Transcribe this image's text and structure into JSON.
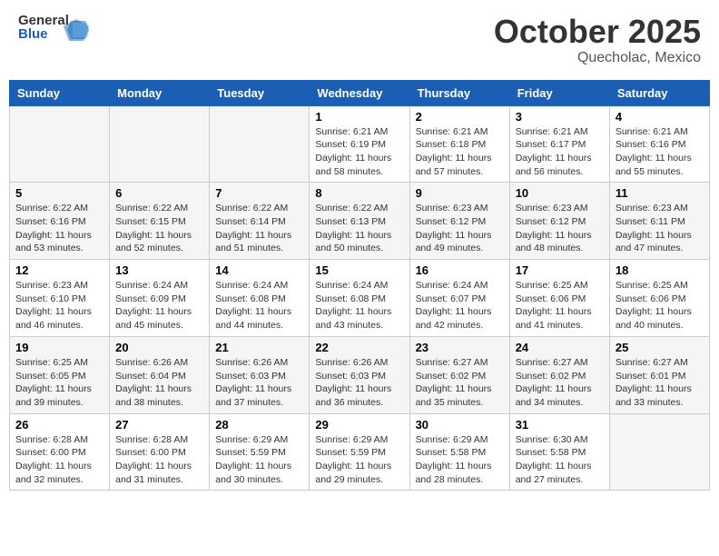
{
  "header": {
    "logo_general": "General",
    "logo_blue": "Blue",
    "month_title": "October 2025",
    "location": "Quecholac, Mexico"
  },
  "weekdays": [
    "Sunday",
    "Monday",
    "Tuesday",
    "Wednesday",
    "Thursday",
    "Friday",
    "Saturday"
  ],
  "weeks": [
    [
      {
        "day": "",
        "info": ""
      },
      {
        "day": "",
        "info": ""
      },
      {
        "day": "",
        "info": ""
      },
      {
        "day": "1",
        "info": "Sunrise: 6:21 AM\nSunset: 6:19 PM\nDaylight: 11 hours and 58 minutes."
      },
      {
        "day": "2",
        "info": "Sunrise: 6:21 AM\nSunset: 6:18 PM\nDaylight: 11 hours and 57 minutes."
      },
      {
        "day": "3",
        "info": "Sunrise: 6:21 AM\nSunset: 6:17 PM\nDaylight: 11 hours and 56 minutes."
      },
      {
        "day": "4",
        "info": "Sunrise: 6:21 AM\nSunset: 6:16 PM\nDaylight: 11 hours and 55 minutes."
      }
    ],
    [
      {
        "day": "5",
        "info": "Sunrise: 6:22 AM\nSunset: 6:16 PM\nDaylight: 11 hours and 53 minutes."
      },
      {
        "day": "6",
        "info": "Sunrise: 6:22 AM\nSunset: 6:15 PM\nDaylight: 11 hours and 52 minutes."
      },
      {
        "day": "7",
        "info": "Sunrise: 6:22 AM\nSunset: 6:14 PM\nDaylight: 11 hours and 51 minutes."
      },
      {
        "day": "8",
        "info": "Sunrise: 6:22 AM\nSunset: 6:13 PM\nDaylight: 11 hours and 50 minutes."
      },
      {
        "day": "9",
        "info": "Sunrise: 6:23 AM\nSunset: 6:12 PM\nDaylight: 11 hours and 49 minutes."
      },
      {
        "day": "10",
        "info": "Sunrise: 6:23 AM\nSunset: 6:12 PM\nDaylight: 11 hours and 48 minutes."
      },
      {
        "day": "11",
        "info": "Sunrise: 6:23 AM\nSunset: 6:11 PM\nDaylight: 11 hours and 47 minutes."
      }
    ],
    [
      {
        "day": "12",
        "info": "Sunrise: 6:23 AM\nSunset: 6:10 PM\nDaylight: 11 hours and 46 minutes."
      },
      {
        "day": "13",
        "info": "Sunrise: 6:24 AM\nSunset: 6:09 PM\nDaylight: 11 hours and 45 minutes."
      },
      {
        "day": "14",
        "info": "Sunrise: 6:24 AM\nSunset: 6:08 PM\nDaylight: 11 hours and 44 minutes."
      },
      {
        "day": "15",
        "info": "Sunrise: 6:24 AM\nSunset: 6:08 PM\nDaylight: 11 hours and 43 minutes."
      },
      {
        "day": "16",
        "info": "Sunrise: 6:24 AM\nSunset: 6:07 PM\nDaylight: 11 hours and 42 minutes."
      },
      {
        "day": "17",
        "info": "Sunrise: 6:25 AM\nSunset: 6:06 PM\nDaylight: 11 hours and 41 minutes."
      },
      {
        "day": "18",
        "info": "Sunrise: 6:25 AM\nSunset: 6:06 PM\nDaylight: 11 hours and 40 minutes."
      }
    ],
    [
      {
        "day": "19",
        "info": "Sunrise: 6:25 AM\nSunset: 6:05 PM\nDaylight: 11 hours and 39 minutes."
      },
      {
        "day": "20",
        "info": "Sunrise: 6:26 AM\nSunset: 6:04 PM\nDaylight: 11 hours and 38 minutes."
      },
      {
        "day": "21",
        "info": "Sunrise: 6:26 AM\nSunset: 6:03 PM\nDaylight: 11 hours and 37 minutes."
      },
      {
        "day": "22",
        "info": "Sunrise: 6:26 AM\nSunset: 6:03 PM\nDaylight: 11 hours and 36 minutes."
      },
      {
        "day": "23",
        "info": "Sunrise: 6:27 AM\nSunset: 6:02 PM\nDaylight: 11 hours and 35 minutes."
      },
      {
        "day": "24",
        "info": "Sunrise: 6:27 AM\nSunset: 6:02 PM\nDaylight: 11 hours and 34 minutes."
      },
      {
        "day": "25",
        "info": "Sunrise: 6:27 AM\nSunset: 6:01 PM\nDaylight: 11 hours and 33 minutes."
      }
    ],
    [
      {
        "day": "26",
        "info": "Sunrise: 6:28 AM\nSunset: 6:00 PM\nDaylight: 11 hours and 32 minutes."
      },
      {
        "day": "27",
        "info": "Sunrise: 6:28 AM\nSunset: 6:00 PM\nDaylight: 11 hours and 31 minutes."
      },
      {
        "day": "28",
        "info": "Sunrise: 6:29 AM\nSunset: 5:59 PM\nDaylight: 11 hours and 30 minutes."
      },
      {
        "day": "29",
        "info": "Sunrise: 6:29 AM\nSunset: 5:59 PM\nDaylight: 11 hours and 29 minutes."
      },
      {
        "day": "30",
        "info": "Sunrise: 6:29 AM\nSunset: 5:58 PM\nDaylight: 11 hours and 28 minutes."
      },
      {
        "day": "31",
        "info": "Sunrise: 6:30 AM\nSunset: 5:58 PM\nDaylight: 11 hours and 27 minutes."
      },
      {
        "day": "",
        "info": ""
      }
    ]
  ]
}
